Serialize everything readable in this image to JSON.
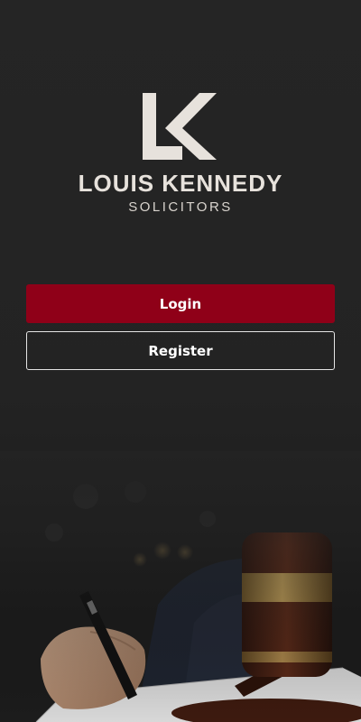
{
  "brand": {
    "name": "LOUIS KENNEDY",
    "tagline": "SOLICITORS",
    "logo_icon": "lk-monogram-icon",
    "logo_color": "#e7e2dc"
  },
  "actions": {
    "login_label": "Login",
    "register_label": "Register"
  },
  "colors": {
    "background": "#232323",
    "primary_button": "#8f0018",
    "outline_button_border": "#e5e5e5"
  },
  "background_image": {
    "description_icon": "lawyer-signing-with-gavel-photo"
  }
}
